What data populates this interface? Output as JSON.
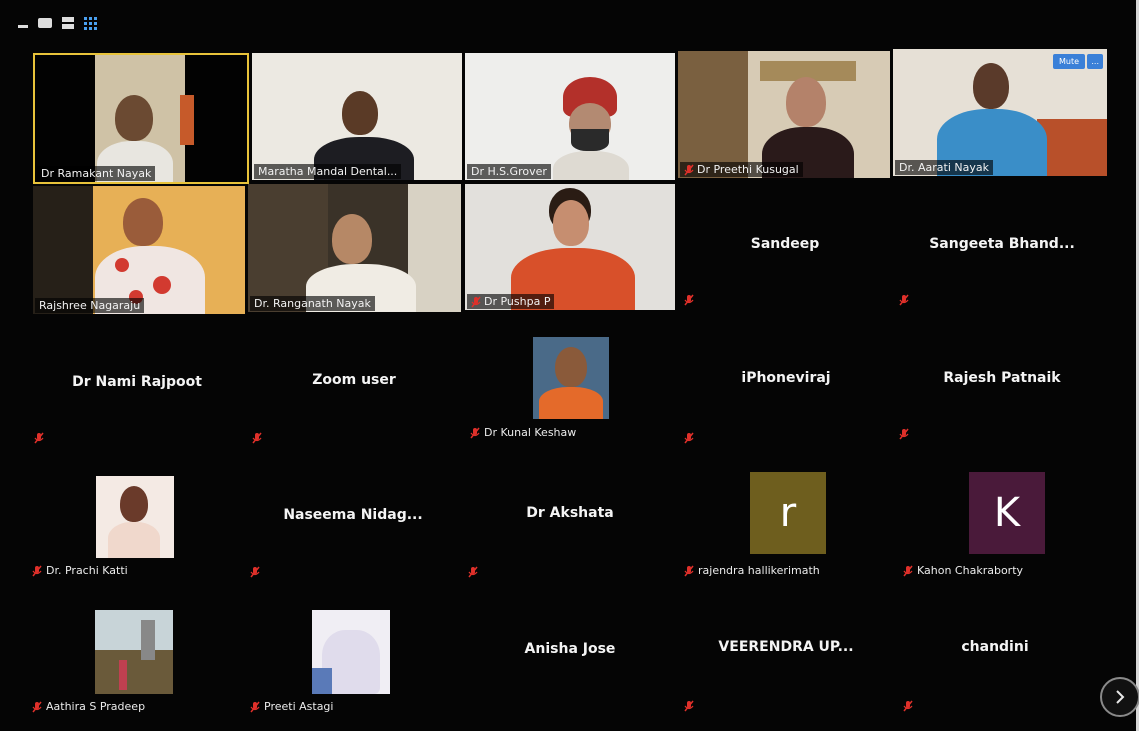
{
  "toolbar": {
    "icons": [
      "minimize-icon",
      "speaker-view-icon",
      "gallery-view-icon"
    ]
  },
  "video_tiles": [
    {
      "name": "Dr Ramakant Nayak"
    },
    {
      "name": "Maratha Mandal Dental..."
    },
    {
      "name": "Dr H.S.Grover"
    },
    {
      "name": "Dr Preethi Kusugal"
    },
    {
      "name": "Dr. Aarati Nayak"
    },
    {
      "name": "Rajshree Nagaraju"
    },
    {
      "name": "Dr. Ranganath Nayak"
    },
    {
      "name": "Dr Pushpa P"
    }
  ],
  "aarati_controls": {
    "mute": "Mute",
    "more": "..."
  },
  "name_tiles": [
    {
      "name": "Sandeep"
    },
    {
      "name": "Sangeeta  Bhand..."
    },
    {
      "name": "Dr Nami Rajpoot"
    },
    {
      "name": "Zoom user"
    },
    {
      "name": "iPhoneviraj"
    },
    {
      "name": "Rajesh Patnaik"
    },
    {
      "name": "Naseema  Nidag..."
    },
    {
      "name": "Dr Akshata"
    },
    {
      "name": "Anisha Jose"
    },
    {
      "name": "VEERENDRA  UP..."
    },
    {
      "name": "chandini"
    }
  ],
  "photo_tiles": [
    {
      "label": "Dr Kunal Keshaw"
    },
    {
      "label": "Dr. Prachi Katti"
    },
    {
      "label": "Aathira S Pradeep"
    },
    {
      "label": "Preeti Astagi"
    }
  ],
  "avatar_tiles": [
    {
      "letter": "r",
      "label": "rajendra hallikerimath",
      "color": "#6e5e1e"
    },
    {
      "letter": "K",
      "label": "Kahon Chakraborty",
      "color": "#4a1a3a"
    }
  ],
  "colors": {
    "active_border": "#e8c33a",
    "muted_mic": "#e0302a",
    "background": "#050505"
  }
}
